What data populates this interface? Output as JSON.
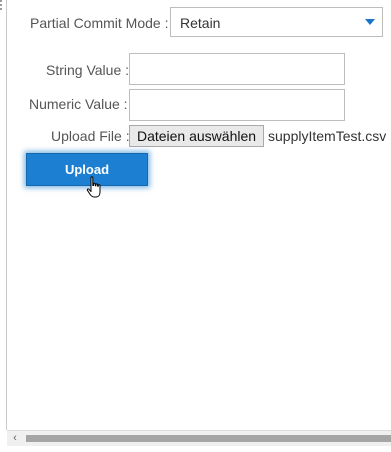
{
  "form": {
    "partial_commit_label": "Partial Commit Mode :",
    "partial_commit_value": "Retain",
    "string_value_label": "String Value :",
    "string_value": "",
    "numeric_value_label": "Numeric Value :",
    "numeric_value": "",
    "upload_file_label": "Upload File :",
    "file_button_label": "Dateien auswählen",
    "file_name": "supplyItemTest.csv",
    "upload_button_label": "Upload"
  },
  "icons": {
    "dropdown": "chevron-down-icon",
    "cursor": "hand-pointer-icon",
    "scroll_left": "chevron-left-icon"
  },
  "colors": {
    "accent": "#1c7fd2",
    "caret": "#1a73c9"
  }
}
